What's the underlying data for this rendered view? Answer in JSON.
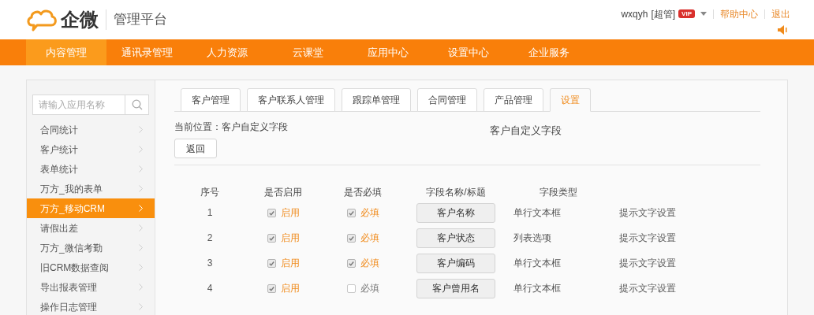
{
  "header": {
    "logo_text": "企微",
    "subtitle": "管理平台",
    "user": "wxqyh",
    "role": "[超管]",
    "badge": "VIP",
    "links": [
      "帮助中心",
      "退出"
    ]
  },
  "nav": [
    {
      "label": "内容管理",
      "selected": true
    },
    {
      "label": "通讯录管理",
      "selected": false
    },
    {
      "label": "人力资源",
      "selected": false
    },
    {
      "label": "云课堂",
      "selected": false
    },
    {
      "label": "应用中心",
      "selected": false
    },
    {
      "label": "设置中心",
      "selected": false
    },
    {
      "label": "企业服务",
      "selected": false
    }
  ],
  "sidebar": {
    "search": {
      "placeholder": "请输入应用名称"
    },
    "items": [
      {
        "label": "合同统计",
        "selected": false
      },
      {
        "label": "客户统计",
        "selected": false
      },
      {
        "label": "表单统计",
        "selected": false
      },
      {
        "label": "万方_我的表单",
        "selected": false
      },
      {
        "label": "万方_移动CRM",
        "selected": true
      },
      {
        "label": "请假出差",
        "selected": false
      },
      {
        "label": "万方_微信考勤",
        "selected": false
      },
      {
        "label": "旧CRM数据查阅",
        "selected": false
      },
      {
        "label": "导出报表管理",
        "selected": false
      },
      {
        "label": "操作日志管理",
        "selected": false
      }
    ]
  },
  "tabs": [
    {
      "label": "客户管理",
      "selected": false
    },
    {
      "label": "客户联系人管理",
      "selected": false
    },
    {
      "label": "跟踪单管理",
      "selected": false
    },
    {
      "label": "合同管理",
      "selected": false
    },
    {
      "label": "产品管理",
      "selected": false
    },
    {
      "label": "设置",
      "selected": true
    }
  ],
  "breadcrumb": "当前位置：客户自定义字段",
  "page_title": "客户自定义字段",
  "back_button": "返回",
  "table": {
    "columns": [
      "序号",
      "是否启用",
      "是否必填",
      "字段名称/标题",
      "字段类型"
    ],
    "rows": [
      {
        "index": "1",
        "enabled": {
          "checked": true,
          "label": "启用"
        },
        "required": {
          "checked": true,
          "label": "必填"
        },
        "field_name": "客户名称",
        "field_type": "单行文本框",
        "action": "提示文字设置"
      },
      {
        "index": "2",
        "enabled": {
          "checked": true,
          "label": "启用"
        },
        "required": {
          "checked": true,
          "label": "必填"
        },
        "field_name": "客户状态",
        "field_type": "列表选项",
        "action": "提示文字设置"
      },
      {
        "index": "3",
        "enabled": {
          "checked": true,
          "label": "启用"
        },
        "required": {
          "checked": true,
          "label": "必填"
        },
        "field_name": "客户编码",
        "field_type": "单行文本框",
        "action": "提示文字设置"
      },
      {
        "index": "4",
        "enabled": {
          "checked": true,
          "label": "启用"
        },
        "required": {
          "checked": false,
          "label": "必填"
        },
        "field_name": "客户曾用名",
        "field_type": "单行文本框",
        "action": "提示文字设置"
      }
    ]
  }
}
